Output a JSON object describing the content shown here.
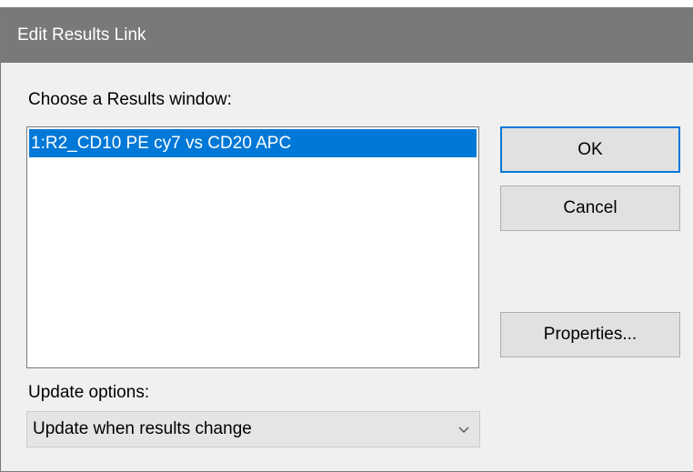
{
  "window": {
    "title": "Edit Results Link"
  },
  "results": {
    "label": "Choose a Results window:",
    "items": [
      "1:R2_CD10 PE cy7 vs CD20 APC"
    ],
    "selected_index": 0
  },
  "buttons": {
    "ok": "OK",
    "cancel": "Cancel",
    "properties": "Properties..."
  },
  "update": {
    "label": "Update options:",
    "selected": "Update when results change"
  },
  "colors": {
    "titlebar": "#797979",
    "selection": "#0078d7",
    "default_button_border": "#0078d7"
  }
}
